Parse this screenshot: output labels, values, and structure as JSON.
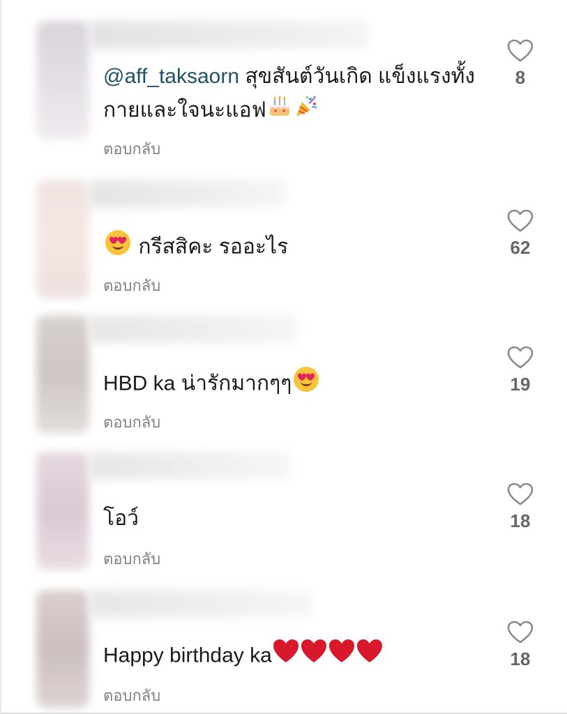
{
  "comments": [
    {
      "mention": "@aff_taksaorn",
      "text": " สุขสันต์วันเกิด แข็งแรงทั้งกายและใจนะแอฟ",
      "emojis": [
        "birthday-cake",
        "party-popper"
      ],
      "reply_label": "ตอบกลับ",
      "like_count": "8"
    },
    {
      "mention": "",
      "text": " กรีสสิคะ รออะไร",
      "emojis_before": [
        "heart-eyes-face"
      ],
      "reply_label": "ตอบกลับ",
      "like_count": "62"
    },
    {
      "mention": "",
      "text": "HBD ka น่ารักมากๆๆ",
      "emojis": [
        "heart-eyes-face"
      ],
      "reply_label": "ตอบกลับ",
      "like_count": "19"
    },
    {
      "mention": "",
      "text": "โอว์",
      "reply_label": "ตอบกลับ",
      "like_count": "18"
    },
    {
      "mention": "",
      "text": "Happy birthday ka",
      "emojis": [
        "red-heart",
        "red-heart",
        "red-heart",
        "red-heart"
      ],
      "reply_label": "ตอบกลับ",
      "like_count": "18"
    }
  ],
  "colors": {
    "text": "#1a1a1a",
    "mention": "#21506b",
    "secondary": "#808080",
    "like_count": "#666666",
    "heart_outline": "#8a8a8a",
    "red_heart": "#d7192b"
  }
}
